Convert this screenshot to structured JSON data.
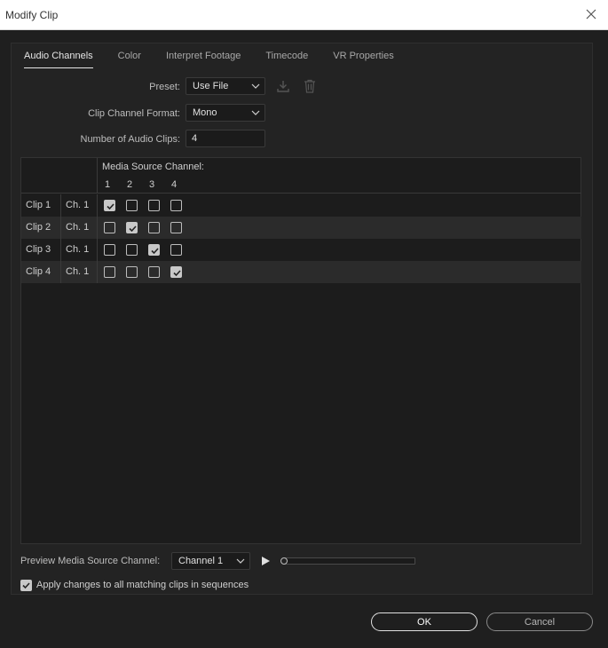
{
  "window": {
    "title": "Modify Clip"
  },
  "tabs": [
    {
      "label": "Audio Channels",
      "active": true
    },
    {
      "label": "Color",
      "active": false
    },
    {
      "label": "Interpret Footage",
      "active": false
    },
    {
      "label": "Timecode",
      "active": false
    },
    {
      "label": "VR Properties",
      "active": false
    }
  ],
  "form": {
    "preset_label": "Preset:",
    "preset_value": "Use File",
    "format_label": "Clip Channel Format:",
    "format_value": "Mono",
    "num_clips_label": "Number of Audio Clips:",
    "num_clips_value": "4"
  },
  "grid": {
    "header": "Media Source Channel:",
    "channels": [
      "1",
      "2",
      "3",
      "4"
    ],
    "rows": [
      {
        "clip": "Clip 1",
        "ch": "Ch. 1",
        "checked": [
          true,
          false,
          false,
          false
        ]
      },
      {
        "clip": "Clip 2",
        "ch": "Ch. 1",
        "checked": [
          false,
          true,
          false,
          false
        ]
      },
      {
        "clip": "Clip 3",
        "ch": "Ch. 1",
        "checked": [
          false,
          false,
          true,
          false
        ]
      },
      {
        "clip": "Clip 4",
        "ch": "Ch. 1",
        "checked": [
          false,
          false,
          false,
          true
        ]
      }
    ]
  },
  "preview": {
    "label": "Preview Media Source Channel:",
    "channel_value": "Channel 1",
    "position": 0
  },
  "apply": {
    "label": "Apply changes to all matching clips in sequences",
    "checked": true
  },
  "buttons": {
    "ok": "OK",
    "cancel": "Cancel"
  },
  "colors": {
    "background": "#1f1f1f",
    "panel": "#232323",
    "text": "#cfcfcf",
    "checkbox_on": "#c8c8c8"
  }
}
